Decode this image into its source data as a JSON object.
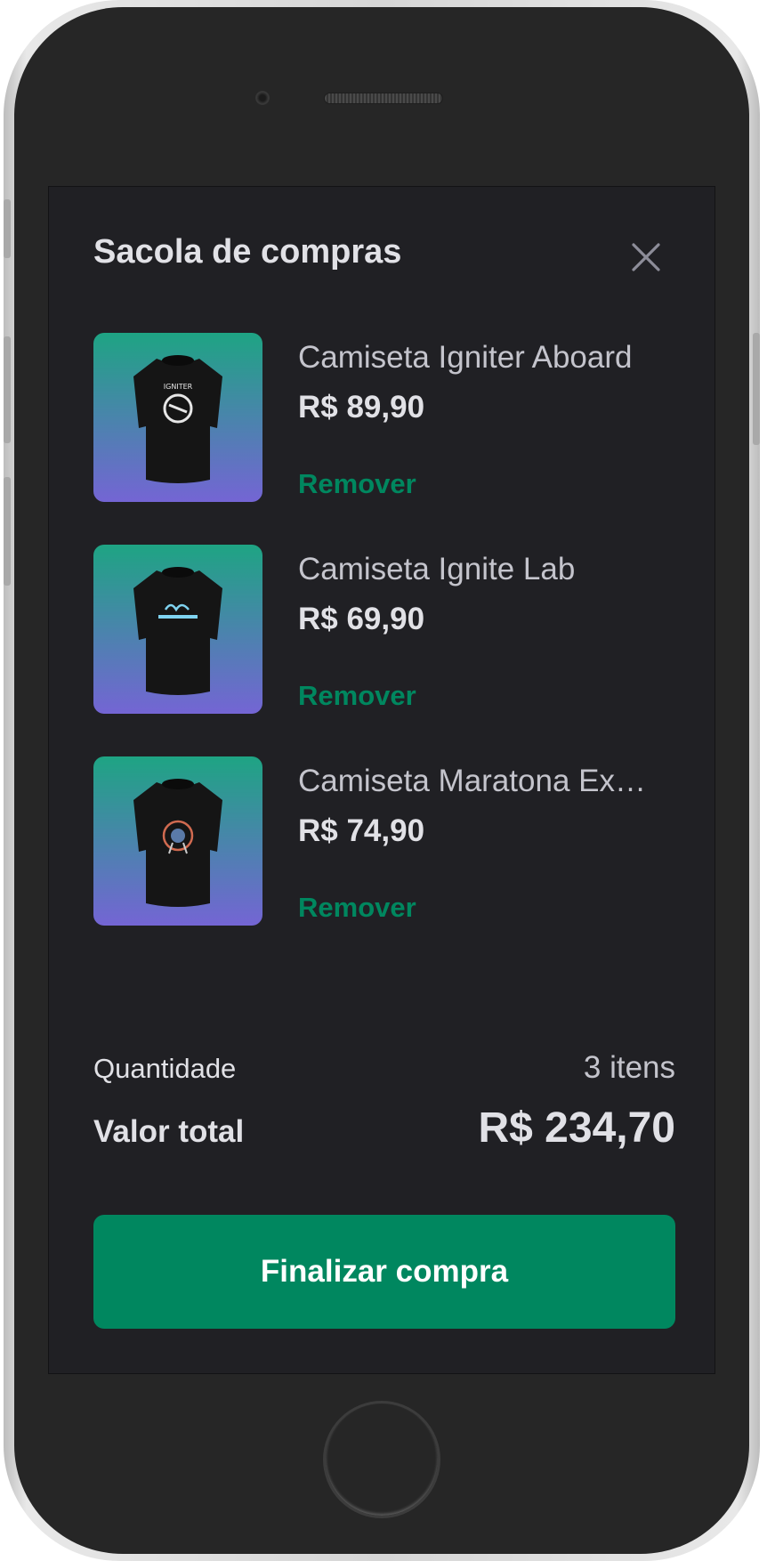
{
  "colors": {
    "screen_bg": "#202024",
    "accent": "#00875f",
    "text_primary": "#e1e1e6",
    "text_secondary": "#c4c4cc",
    "image_gradient": [
      "#1ea483",
      "#7465d4"
    ]
  },
  "bag": {
    "title": "Sacola de compras",
    "close_icon": "close-icon"
  },
  "items": [
    {
      "name": "Camiseta Igniter Aboard",
      "price": "R$ 89,90",
      "remove_label": "Remover",
      "icon": "t-shirt-icon"
    },
    {
      "name": "Camiseta Ignite Lab",
      "price": "R$ 69,90",
      "remove_label": "Remover",
      "icon": "t-shirt-icon"
    },
    {
      "name": "Camiseta Maratona Explorer",
      "price": "R$ 74,90",
      "remove_label": "Remover",
      "icon": "t-shirt-icon"
    }
  ],
  "summary": {
    "quantity_label": "Quantidade",
    "quantity_value": "3 itens",
    "total_label": "Valor total",
    "total_value": "R$ 234,70"
  },
  "checkout_label": "Finalizar compra"
}
